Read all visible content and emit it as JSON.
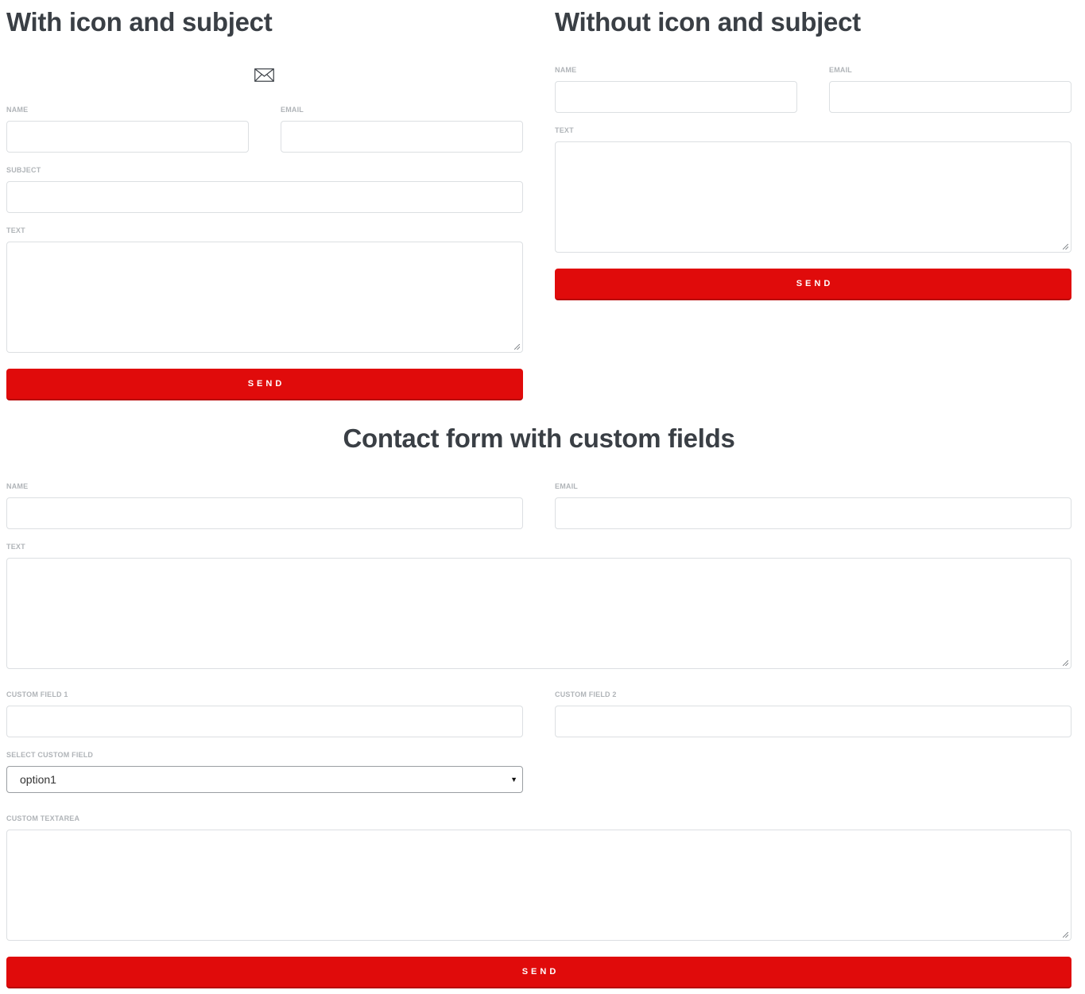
{
  "form1": {
    "title": "With icon and subject",
    "icon": "envelope-icon",
    "name_label": "NAME",
    "email_label": "EMAIL",
    "subject_label": "SUBJECT",
    "text_label": "TEXT",
    "send_label": "SEND"
  },
  "form2": {
    "title": "Without icon and subject",
    "name_label": "NAME",
    "email_label": "EMAIL",
    "text_label": "TEXT",
    "send_label": "SEND"
  },
  "form3": {
    "title": "Contact form with custom fields",
    "name_label": "NAME",
    "email_label": "EMAIL",
    "text_label": "TEXT",
    "custom1_label": "CUSTOM FIELD 1",
    "custom2_label": "CUSTOM FIELD 2",
    "select_label": "SELECT CUSTOM FIELD",
    "select_value": "option1",
    "custom_textarea_label": "CUSTOM TEXTAREA",
    "send_label": "SEND"
  },
  "colors": {
    "accent": "#e00b0b",
    "heading": "#3a3f45",
    "label": "#b0b4b8",
    "border": "#dcdfe2"
  }
}
